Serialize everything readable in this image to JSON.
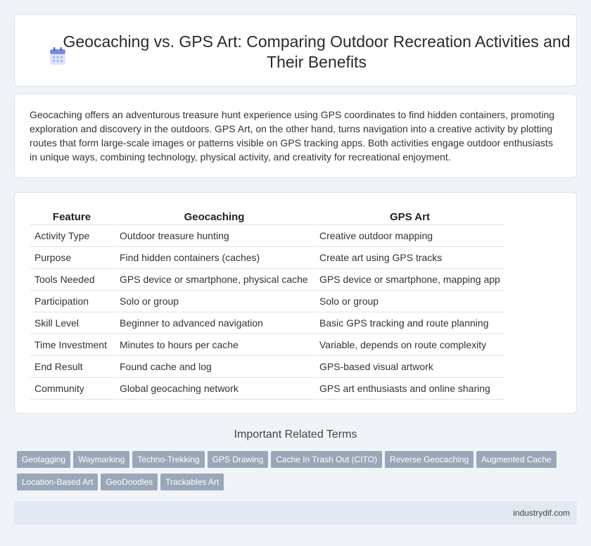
{
  "header": {
    "title": "Geocaching vs. GPS Art: Comparing Outdoor Recreation Activities and Their Benefits",
    "icon": "calendar-icon"
  },
  "intro": {
    "text": "Geocaching offers an adventurous treasure hunt experience using GPS coordinates to find hidden containers, promoting exploration and discovery in the outdoors. GPS Art, on the other hand, turns navigation into a creative activity by plotting routes that form large-scale images or patterns visible on GPS tracking apps. Both activities engage outdoor enthusiasts in unique ways, combining technology, physical activity, and creativity for recreational enjoyment."
  },
  "table": {
    "headers": [
      "Feature",
      "Geocaching",
      "GPS Art"
    ],
    "rows": [
      [
        "Activity Type",
        "Outdoor treasure hunting",
        "Creative outdoor mapping"
      ],
      [
        "Purpose",
        "Find hidden containers (caches)",
        "Create art using GPS tracks"
      ],
      [
        "Tools Needed",
        "GPS device or smartphone, physical cache",
        "GPS device or smartphone, mapping app"
      ],
      [
        "Participation",
        "Solo or group",
        "Solo or group"
      ],
      [
        "Skill Level",
        "Beginner to advanced navigation",
        "Basic GPS tracking and route planning"
      ],
      [
        "Time Investment",
        "Minutes to hours per cache",
        "Variable, depends on route complexity"
      ],
      [
        "End Result",
        "Found cache and log",
        "GPS-based visual artwork"
      ],
      [
        "Community",
        "Global geocaching network",
        "GPS art enthusiasts and online sharing"
      ]
    ]
  },
  "related": {
    "title": "Important Related Terms",
    "tags": [
      "Geotagging",
      "Waymarking",
      "Techno-Trekking",
      "GPS Drawing",
      "Cache In Trash Out (CITO)",
      "Reverse Geocaching",
      "Augmented Cache",
      "Location-Based Art",
      "GeoDoodles",
      "Trackables Art"
    ]
  },
  "footer": {
    "site": "industrydif.com"
  },
  "colors": {
    "background": "#f0f3f8",
    "tag": "#9aa7b8",
    "footer": "#e3e9f2",
    "icon": "#7a8fe0"
  }
}
